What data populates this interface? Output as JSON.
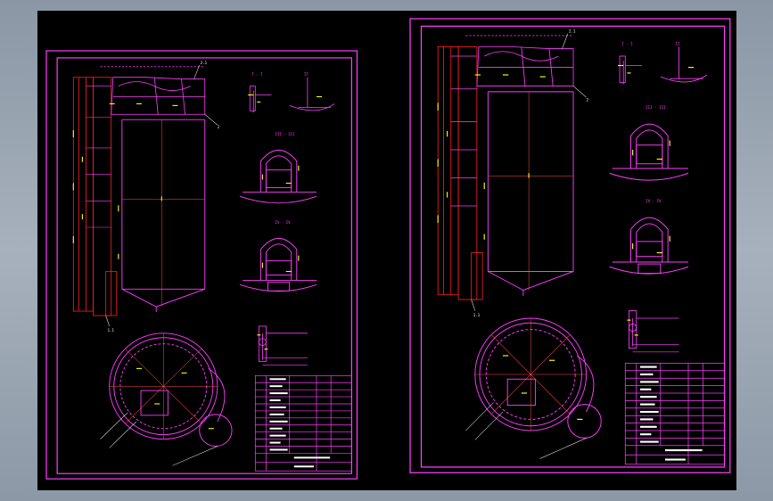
{
  "colors": {
    "background": "#000000",
    "frame": "#ff3cff",
    "outline_red": "#ff1e1e",
    "centerline": "#ff4a4a",
    "dimension": "#ffff00",
    "text": "#ffffff",
    "desktop": "#9aa6b2"
  },
  "sheets": [
    {
      "id": "left",
      "section_labels": [
        "I",
        "II",
        "III",
        "IV"
      ]
    },
    {
      "id": "right",
      "section_labels": [
        "I",
        "II",
        "III",
        "IV"
      ]
    }
  ]
}
